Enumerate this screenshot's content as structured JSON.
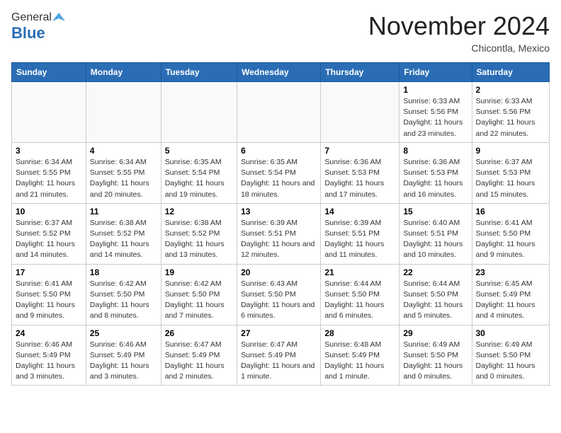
{
  "header": {
    "logo_general": "General",
    "logo_blue": "Blue",
    "month_title": "November 2024",
    "location": "Chicontla, Mexico"
  },
  "days_of_week": [
    "Sunday",
    "Monday",
    "Tuesday",
    "Wednesday",
    "Thursday",
    "Friday",
    "Saturday"
  ],
  "weeks": [
    [
      {
        "day": "",
        "info": ""
      },
      {
        "day": "",
        "info": ""
      },
      {
        "day": "",
        "info": ""
      },
      {
        "day": "",
        "info": ""
      },
      {
        "day": "",
        "info": ""
      },
      {
        "day": "1",
        "info": "Sunrise: 6:33 AM\nSunset: 5:56 PM\nDaylight: 11 hours and 23 minutes."
      },
      {
        "day": "2",
        "info": "Sunrise: 6:33 AM\nSunset: 5:56 PM\nDaylight: 11 hours and 22 minutes."
      }
    ],
    [
      {
        "day": "3",
        "info": "Sunrise: 6:34 AM\nSunset: 5:55 PM\nDaylight: 11 hours and 21 minutes."
      },
      {
        "day": "4",
        "info": "Sunrise: 6:34 AM\nSunset: 5:55 PM\nDaylight: 11 hours and 20 minutes."
      },
      {
        "day": "5",
        "info": "Sunrise: 6:35 AM\nSunset: 5:54 PM\nDaylight: 11 hours and 19 minutes."
      },
      {
        "day": "6",
        "info": "Sunrise: 6:35 AM\nSunset: 5:54 PM\nDaylight: 11 hours and 18 minutes."
      },
      {
        "day": "7",
        "info": "Sunrise: 6:36 AM\nSunset: 5:53 PM\nDaylight: 11 hours and 17 minutes."
      },
      {
        "day": "8",
        "info": "Sunrise: 6:36 AM\nSunset: 5:53 PM\nDaylight: 11 hours and 16 minutes."
      },
      {
        "day": "9",
        "info": "Sunrise: 6:37 AM\nSunset: 5:53 PM\nDaylight: 11 hours and 15 minutes."
      }
    ],
    [
      {
        "day": "10",
        "info": "Sunrise: 6:37 AM\nSunset: 5:52 PM\nDaylight: 11 hours and 14 minutes."
      },
      {
        "day": "11",
        "info": "Sunrise: 6:38 AM\nSunset: 5:52 PM\nDaylight: 11 hours and 14 minutes."
      },
      {
        "day": "12",
        "info": "Sunrise: 6:38 AM\nSunset: 5:52 PM\nDaylight: 11 hours and 13 minutes."
      },
      {
        "day": "13",
        "info": "Sunrise: 6:39 AM\nSunset: 5:51 PM\nDaylight: 11 hours and 12 minutes."
      },
      {
        "day": "14",
        "info": "Sunrise: 6:39 AM\nSunset: 5:51 PM\nDaylight: 11 hours and 11 minutes."
      },
      {
        "day": "15",
        "info": "Sunrise: 6:40 AM\nSunset: 5:51 PM\nDaylight: 11 hours and 10 minutes."
      },
      {
        "day": "16",
        "info": "Sunrise: 6:41 AM\nSunset: 5:50 PM\nDaylight: 11 hours and 9 minutes."
      }
    ],
    [
      {
        "day": "17",
        "info": "Sunrise: 6:41 AM\nSunset: 5:50 PM\nDaylight: 11 hours and 9 minutes."
      },
      {
        "day": "18",
        "info": "Sunrise: 6:42 AM\nSunset: 5:50 PM\nDaylight: 11 hours and 8 minutes."
      },
      {
        "day": "19",
        "info": "Sunrise: 6:42 AM\nSunset: 5:50 PM\nDaylight: 11 hours and 7 minutes."
      },
      {
        "day": "20",
        "info": "Sunrise: 6:43 AM\nSunset: 5:50 PM\nDaylight: 11 hours and 6 minutes."
      },
      {
        "day": "21",
        "info": "Sunrise: 6:44 AM\nSunset: 5:50 PM\nDaylight: 11 hours and 6 minutes."
      },
      {
        "day": "22",
        "info": "Sunrise: 6:44 AM\nSunset: 5:50 PM\nDaylight: 11 hours and 5 minutes."
      },
      {
        "day": "23",
        "info": "Sunrise: 6:45 AM\nSunset: 5:49 PM\nDaylight: 11 hours and 4 minutes."
      }
    ],
    [
      {
        "day": "24",
        "info": "Sunrise: 6:46 AM\nSunset: 5:49 PM\nDaylight: 11 hours and 3 minutes."
      },
      {
        "day": "25",
        "info": "Sunrise: 6:46 AM\nSunset: 5:49 PM\nDaylight: 11 hours and 3 minutes."
      },
      {
        "day": "26",
        "info": "Sunrise: 6:47 AM\nSunset: 5:49 PM\nDaylight: 11 hours and 2 minutes."
      },
      {
        "day": "27",
        "info": "Sunrise: 6:47 AM\nSunset: 5:49 PM\nDaylight: 11 hours and 1 minute."
      },
      {
        "day": "28",
        "info": "Sunrise: 6:48 AM\nSunset: 5:49 PM\nDaylight: 11 hours and 1 minute."
      },
      {
        "day": "29",
        "info": "Sunrise: 6:49 AM\nSunset: 5:50 PM\nDaylight: 11 hours and 0 minutes."
      },
      {
        "day": "30",
        "info": "Sunrise: 6:49 AM\nSunset: 5:50 PM\nDaylight: 11 hours and 0 minutes."
      }
    ]
  ]
}
